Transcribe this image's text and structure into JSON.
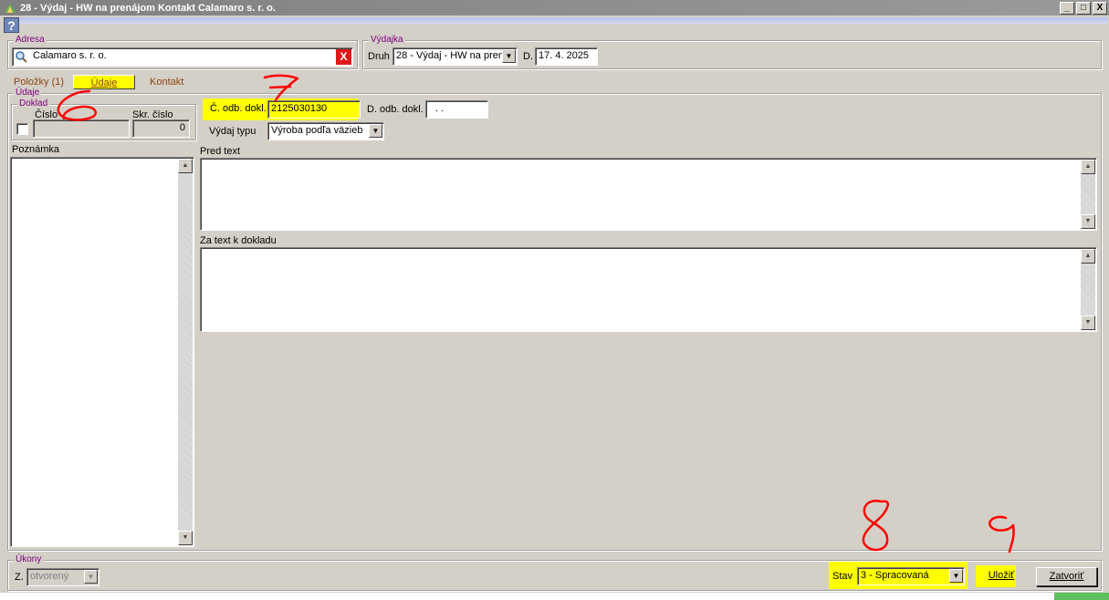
{
  "window": {
    "title": "28 - Výdaj - HW na prenájom  Kontakt Calamaro s. r. o.",
    "minimize": "_",
    "maximize": "□",
    "close": "X"
  },
  "help": "?",
  "adresa": {
    "legend": "Adresa",
    "value": "Calamaro s. r. o.",
    "clear": "X"
  },
  "vydajka": {
    "legend": "Výdajka",
    "druh_label": "Druh",
    "druh_value": "28 - Výdaj - HW na prená",
    "d_label": "D.",
    "date": "17. 4. 2025"
  },
  "tabs": [
    {
      "label": "Položky (1)"
    },
    {
      "label": "Údaje"
    },
    {
      "label": "Kontakt"
    }
  ],
  "udaje": {
    "legend": "Údaje",
    "doklad_legend": "Doklad",
    "cislo_label": "Číslo",
    "cislo_value": "",
    "skr_cislo_label": "Skr. číslo",
    "skr_cislo_value": "0",
    "c_odb_dokl_label": "Č. odb. dokl.",
    "c_odb_dokl_value": "2125030130",
    "d_odb_dokl_label": "D. odb. dokl.",
    "d_odb_dokl_value": " .  .",
    "vydaj_typu_label": "Výdaj typu",
    "vydaj_typu_value": "Výroba podľa väzieb",
    "poznamka_label": "Poznámka",
    "pred_text_label": "Pred text",
    "za_text_label": "Za text k dokladu"
  },
  "ukony": {
    "legend": "Úkony",
    "z_label": "Z.",
    "z_value": "otvorený",
    "stav_label": "Stav",
    "stav_value": "3 - Spracovaná",
    "save_label": "Uložiť",
    "close_label": "Zatvoriť"
  },
  "annotations": [
    "6",
    "7",
    "8",
    "9"
  ],
  "colors": {
    "highlight": "#ffff00",
    "legend": "#800080",
    "tab_text": "#8b4513",
    "annotation": "#ff0000"
  }
}
